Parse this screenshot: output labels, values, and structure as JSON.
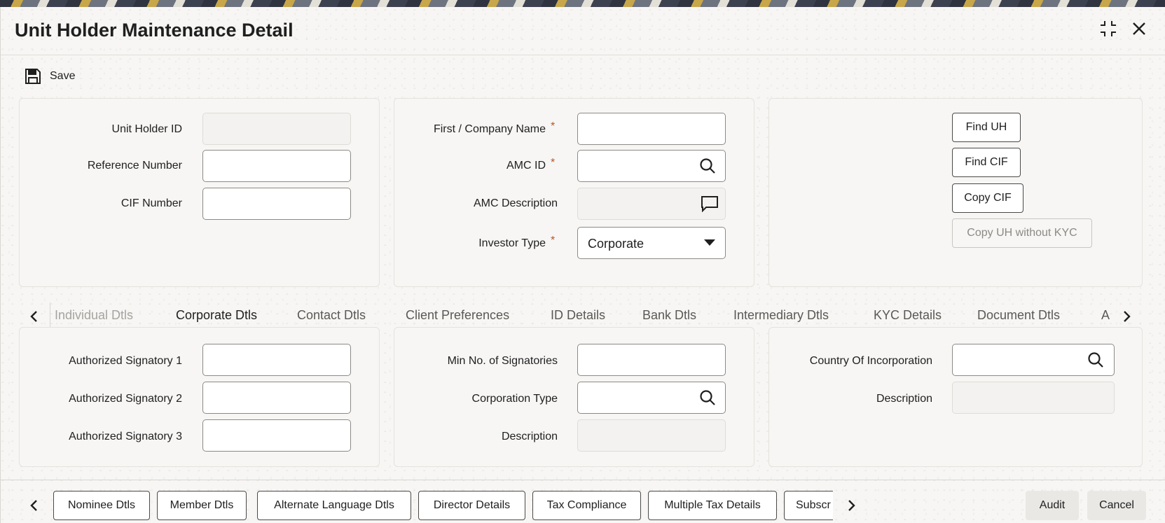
{
  "window": {
    "title": "Unit Holder Maintenance Detail",
    "maximize_icon": "maximize-icon",
    "close_icon": "close-icon"
  },
  "toolbar": {
    "save_label": "Save",
    "save_icon": "floppy-disk-icon"
  },
  "header_panel": {
    "unit_holder_id": {
      "label": "Unit Holder ID",
      "value": ""
    },
    "reference_number": {
      "label": "Reference Number",
      "value": ""
    },
    "cif_number": {
      "label": "CIF Number",
      "value": ""
    },
    "first_company_name": {
      "label": "First / Company Name",
      "required": "*",
      "value": ""
    },
    "amc_id": {
      "label": "AMC ID",
      "required": "*",
      "value": ""
    },
    "amc_description": {
      "label": "AMC Description",
      "value": ""
    },
    "investor_type": {
      "label": "Investor Type",
      "required": "*",
      "value": "Corporate"
    },
    "buttons": {
      "find_uh": "Find UH",
      "find_cif": "Find CIF",
      "copy_cif": "Copy CIF",
      "copy_uh_without_kyc": "Copy UH without KYC"
    }
  },
  "tabs": [
    {
      "label": "Individual Dtls",
      "state": "disabled"
    },
    {
      "label": "Corporate Dtls",
      "state": "active"
    },
    {
      "label": "Contact Dtls",
      "state": "normal"
    },
    {
      "label": "Client Preferences",
      "state": "normal"
    },
    {
      "label": "ID Details",
      "state": "normal"
    },
    {
      "label": "Bank Dtls",
      "state": "normal"
    },
    {
      "label": "Intermediary Dtls",
      "state": "normal"
    },
    {
      "label": "KYC Details",
      "state": "normal"
    },
    {
      "label": "Document Dtls",
      "state": "normal"
    },
    {
      "label": "A",
      "state": "normal"
    }
  ],
  "corporate": {
    "auth_sig_1": {
      "label": "Authorized Signatory 1",
      "value": ""
    },
    "auth_sig_2": {
      "label": "Authorized Signatory 2",
      "value": ""
    },
    "auth_sig_3": {
      "label": "Authorized Signatory 3",
      "value": ""
    },
    "min_signatories": {
      "label": "Min No. of Signatories",
      "value": ""
    },
    "corporation_type": {
      "label": "Corporation Type",
      "value": ""
    },
    "corp_description": {
      "label": "Description",
      "value": ""
    },
    "country_of_incorporation": {
      "label": "Country Of Incorporation",
      "value": ""
    },
    "country_description": {
      "label": "Description",
      "value": ""
    }
  },
  "footer": {
    "buttons": [
      "Nominee Dtls",
      "Member Dtls",
      "Alternate Language Dtls",
      "Director Details",
      "Tax Compliance",
      "Multiple Tax Details",
      "Subscr"
    ],
    "audit": "Audit",
    "cancel": "Cancel"
  },
  "colors": {
    "accent_underline": "#3a5a70",
    "required_star": "#b05a2c",
    "background": "#f7f6f4"
  }
}
